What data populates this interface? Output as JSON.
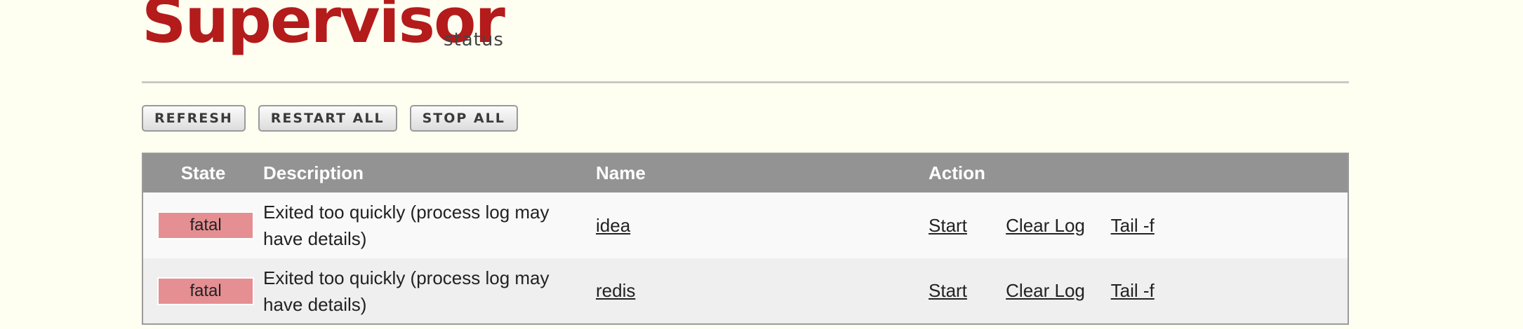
{
  "brand": {
    "title": "Supervisor",
    "subtitle": "status"
  },
  "toolbar": {
    "refresh_label": "REFRESH",
    "restart_all_label": "RESTART ALL",
    "stop_all_label": "STOP ALL"
  },
  "table": {
    "headers": {
      "state": "State",
      "description": "Description",
      "name": "Name",
      "action": "Action"
    },
    "rows": [
      {
        "state": "fatal",
        "description": "Exited too quickly (process log may have details)",
        "name": "idea",
        "actions": [
          "Start",
          "Clear Log",
          "Tail -f"
        ]
      },
      {
        "state": "fatal",
        "description": "Exited too quickly (process log may have details)",
        "name": "redis",
        "actions": [
          "Start",
          "Clear Log",
          "Tail -f"
        ]
      }
    ]
  },
  "colors": {
    "brand": "#b41b1b",
    "fatal_badge": "#e58f93",
    "header_bg": "#939393",
    "page_bg": "#fffff1"
  }
}
